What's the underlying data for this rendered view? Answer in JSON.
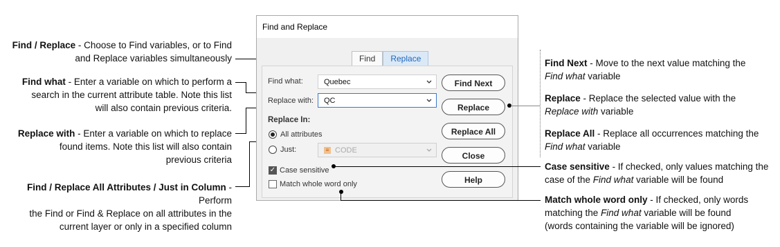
{
  "left_annotations": [
    {
      "title": "Find / Replace",
      "lines": [
        " - Choose to Find variables, or to Find",
        "and Replace variables simultaneously"
      ]
    },
    {
      "title": "Find what",
      "lines": [
        " - Enter a variable on which to perform a",
        "search in the current attribute table. Note this list",
        "will also contain previous criteria."
      ]
    },
    {
      "title": "Replace with",
      "lines": [
        " - Enter a variable on which to replace",
        "found items. Note this list will also contain",
        "previous criteria"
      ]
    },
    {
      "title": "Find / Replace All Attributes / Just in Column",
      "lines": [
        " - Perform",
        "the Find or Find & Replace on all attributes in the",
        "current layer or only in a specified column"
      ]
    }
  ],
  "right_annotations": [
    {
      "title": "Find Next",
      "text": " - Move to the next value matching the",
      "italic": "Find what",
      "tail": " variable"
    },
    {
      "title": "Replace",
      "text": " - Replace the selected value with the",
      "italic": "Replace with",
      "tail": " variable"
    },
    {
      "title": "Replace All",
      "text": " - Replace all occurrences matching the",
      "italic": "Find what",
      "tail": " variable"
    },
    {
      "title": "Case sensitive",
      "text": " - If checked, only values matching the",
      "pre2": "case of the ",
      "italic": "Find what",
      "tail": " variable will be found"
    },
    {
      "title": "Match whole word only",
      "text": " - If checked, only words",
      "pre2": "matching the ",
      "italic": "Find what",
      "tail": " variable will be found",
      "line3": "(words containing the variable will be ignored)"
    }
  ],
  "dialog": {
    "title": "Find and Replace",
    "tabs": [
      "Find",
      "Replace"
    ],
    "active_tab": "Replace",
    "find_what_label": "Find what:",
    "find_what_value": "Quebec",
    "replace_with_label": "Replace with:",
    "replace_with_value": "QC",
    "replace_in_label": "Replace In:",
    "all_attributes_label": "All attributes",
    "just_label": "Just:",
    "just_value": "CODE",
    "case_sensitive_label": "Case sensitive",
    "case_sensitive_checked": true,
    "match_whole_word_label": "Match whole word only",
    "match_whole_word_checked": false,
    "buttons": [
      "Find Next",
      "Replace",
      "Replace All",
      "Close",
      "Help"
    ]
  }
}
